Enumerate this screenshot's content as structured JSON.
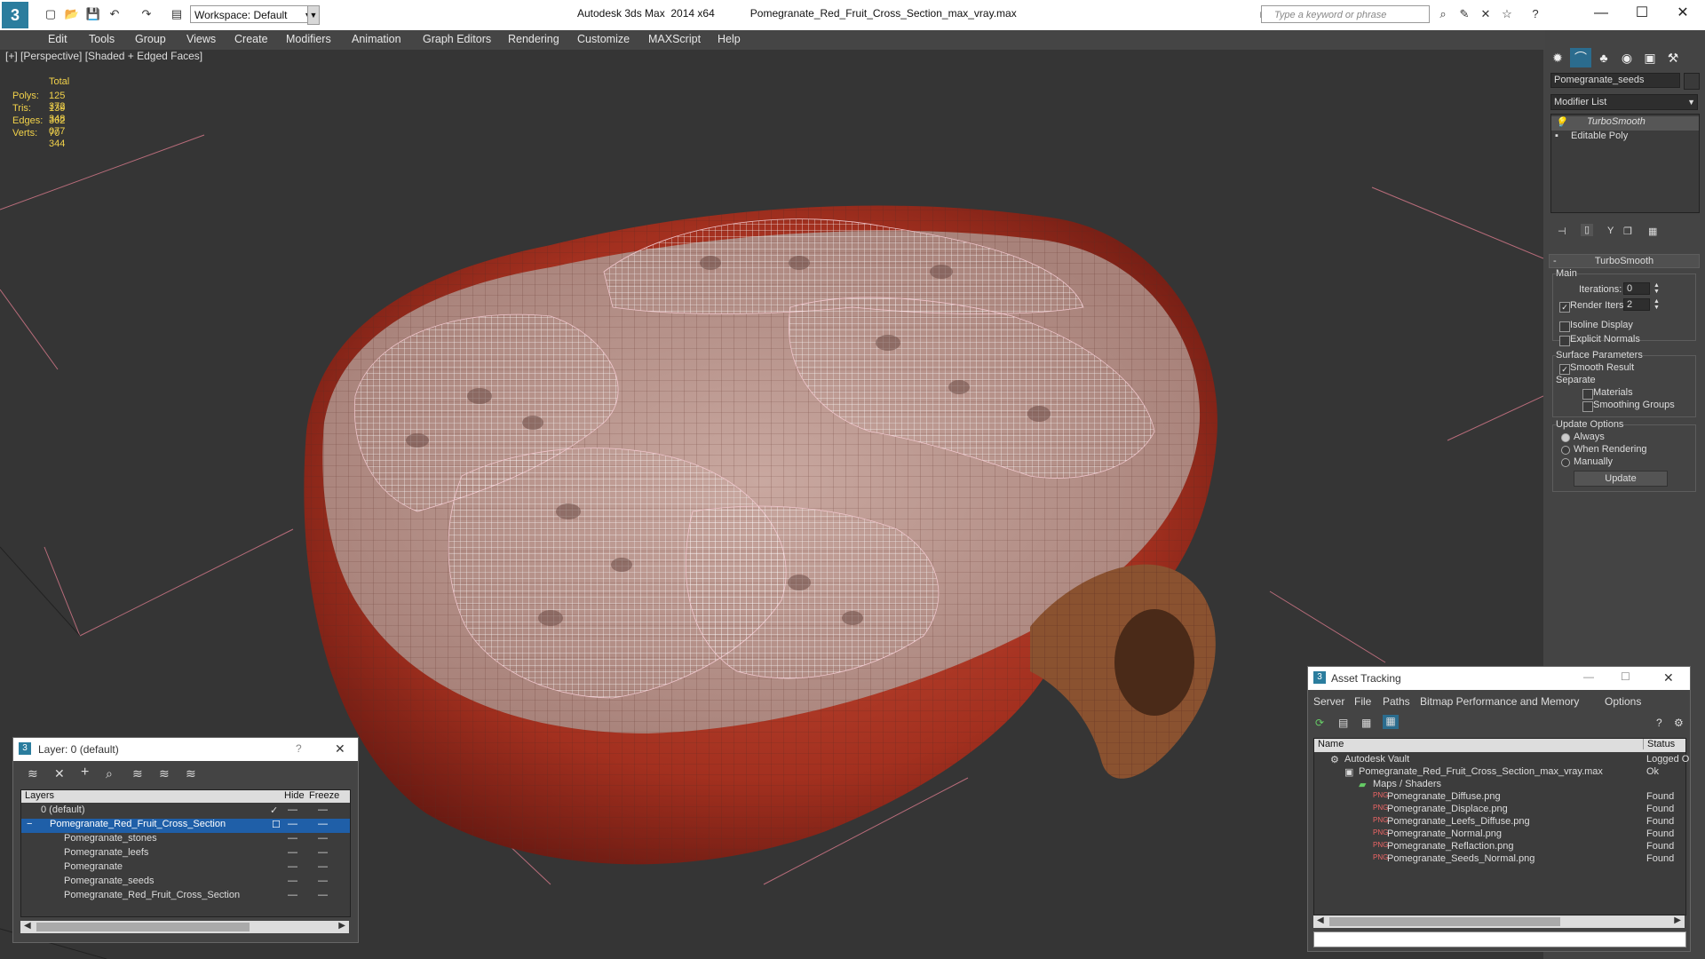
{
  "titlebar": {
    "app_title": "Autodesk 3ds Max  2014 x64",
    "file_title": "Pomegranate_Red_Fruit_Cross_Section_max_vray.max",
    "workspace": "Workspace: Default",
    "search_placeholder": "Type a keyword or phrase"
  },
  "menu": [
    "Edit",
    "Tools",
    "Group",
    "Views",
    "Create",
    "Modifiers",
    "Animation",
    "Graph Editors",
    "Rendering",
    "Customize",
    "MAXScript",
    "Help"
  ],
  "viewport": {
    "label": "[+] [Perspective] [Shaded + Edged Faces]",
    "stats": {
      "header": "Total",
      "rows": [
        {
          "label": "Polys:",
          "value": "125 372"
        },
        {
          "label": "Tris:",
          "value": "139 348"
        },
        {
          "label": "Edges:",
          "value": "362 077"
        },
        {
          "label": "Verts:",
          "value": "70 344"
        }
      ]
    }
  },
  "command_panel": {
    "object_name": "Pomegranate_seeds",
    "modifier_list": "Modifier List",
    "stack": [
      "TurboSmooth",
      "Editable Poly"
    ],
    "rollout_title": "TurboSmooth",
    "main_label": "Main",
    "iterations_label": "Iterations:",
    "iterations_value": "0",
    "render_iters_label": "Render Iters:",
    "render_iters_value": "2",
    "isoline": "Isoline Display",
    "explicit_normals": "Explicit Normals",
    "surface_params": "Surface Parameters",
    "smooth_result": "Smooth Result",
    "separate": "Separate",
    "materials": "Materials",
    "smoothing_groups": "Smoothing Groups",
    "update_options": "Update Options",
    "always": "Always",
    "when_rendering": "When Rendering",
    "manually": "Manually",
    "update_btn": "Update"
  },
  "layers": {
    "title": "Layer: 0 (default)",
    "col_layers": "Layers",
    "col_hide": "Hide",
    "col_freeze": "Freeze",
    "items": [
      "0 (default)",
      "Pomegranate_Red_Fruit_Cross_Section",
      "Pomegranate_stones",
      "Pomegranate_leefs",
      "Pomegranate",
      "Pomegranate_seeds",
      "Pomegranate_Red_Fruit_Cross_Section"
    ]
  },
  "assets": {
    "title": "Asset Tracking",
    "menu": [
      "Server",
      "File",
      "Paths",
      "Bitmap Performance and Memory",
      "Options"
    ],
    "col_name": "Name",
    "col_status": "Status",
    "rows": [
      {
        "name": "Autodesk Vault",
        "status": "Logged O"
      },
      {
        "name": "Pomegranate_Red_Fruit_Cross_Section_max_vray.max",
        "status": "Ok"
      },
      {
        "name": "Maps / Shaders",
        "status": ""
      },
      {
        "name": "Pomegranate_Diffuse.png",
        "status": "Found"
      },
      {
        "name": "Pomegranate_Displace.png",
        "status": "Found"
      },
      {
        "name": "Pomegranate_Leefs_Diffuse.png",
        "status": "Found"
      },
      {
        "name": "Pomegranate_Normal.png",
        "status": "Found"
      },
      {
        "name": "Pomegranate_Reflaction.png",
        "status": "Found"
      },
      {
        "name": "Pomegranate_Seeds_Normal.png",
        "status": "Found"
      }
    ]
  }
}
